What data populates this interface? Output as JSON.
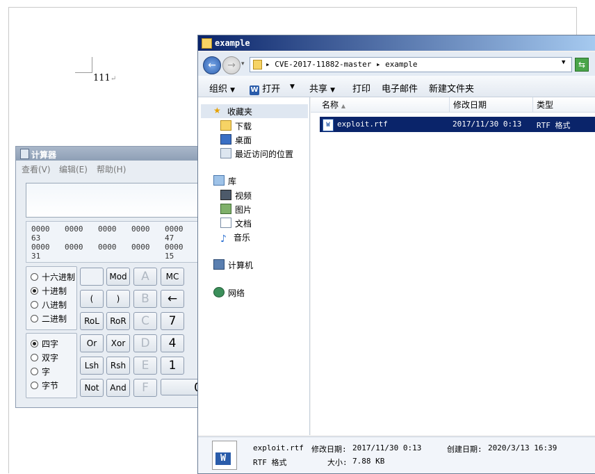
{
  "document": {
    "text": "111"
  },
  "calculator": {
    "title": "计算器",
    "menu": [
      "查看(V)",
      "编辑(E)",
      "帮助(H)"
    ],
    "bits": {
      "row1": [
        "0000",
        "0000",
        "0000",
        "0000",
        "0000"
      ],
      "row1_pos": [
        "63",
        "47"
      ],
      "row2": [
        "0000",
        "0000",
        "0000",
        "0000",
        "0000"
      ],
      "row2_pos": [
        "31",
        "15"
      ]
    },
    "radix": [
      {
        "label": "十六进制",
        "selected": false
      },
      {
        "label": "十进制",
        "selected": true
      },
      {
        "label": "八进制",
        "selected": false
      },
      {
        "label": "二进制",
        "selected": false
      }
    ],
    "wordsize": [
      {
        "label": "四字",
        "selected": true
      },
      {
        "label": "双字",
        "selected": false
      },
      {
        "label": "字",
        "selected": false
      },
      {
        "label": "字节",
        "selected": false
      }
    ],
    "buttons": {
      "mod": "Mod",
      "a": "A",
      "mc": "MC",
      "lparen": "(",
      "rparen": ")",
      "b": "B",
      "backspace": "←",
      "rol": "RoL",
      "ror": "RoR",
      "c": "C",
      "seven": "7",
      "or": "Or",
      "xor": "Xor",
      "d": "D",
      "four": "4",
      "lsh": "Lsh",
      "rsh": "Rsh",
      "e": "E",
      "one": "1",
      "not": "Not",
      "and": "And",
      "f": "F",
      "zero": "0"
    }
  },
  "explorer": {
    "title": "example",
    "breadcrumb": "▸ CVE-2017-11882-master ▸ example",
    "toolbar": {
      "organize": "组织",
      "open": "打开",
      "share": "共享",
      "print": "打印",
      "email": "电子邮件",
      "new_folder": "新建文件夹"
    },
    "nav": {
      "favorites": "收藏夹",
      "downloads": "下载",
      "desktop": "桌面",
      "recent": "最近访问的位置",
      "libraries": "库",
      "videos": "视频",
      "pictures": "图片",
      "documents": "文档",
      "music": "音乐",
      "computer": "计算机",
      "network": "网络"
    },
    "columns": {
      "name": "名称",
      "modified": "修改日期",
      "type": "类型"
    },
    "files": [
      {
        "name": "exploit.rtf",
        "modified": "2017/11/30 0:13",
        "type": "RTF 格式"
      }
    ],
    "status": {
      "filename": "exploit.rtf",
      "modified_label": "修改日期:",
      "modified": "2017/11/30 0:13",
      "created_label": "创建日期:",
      "created": "2020/3/13 16:39",
      "type": "RTF 格式",
      "size_label": "大小:",
      "size": "7.88 KB"
    },
    "colors": {
      "selection": "#0a246a",
      "title_start": "#0a246a",
      "title_end": "#a6caf0"
    }
  }
}
